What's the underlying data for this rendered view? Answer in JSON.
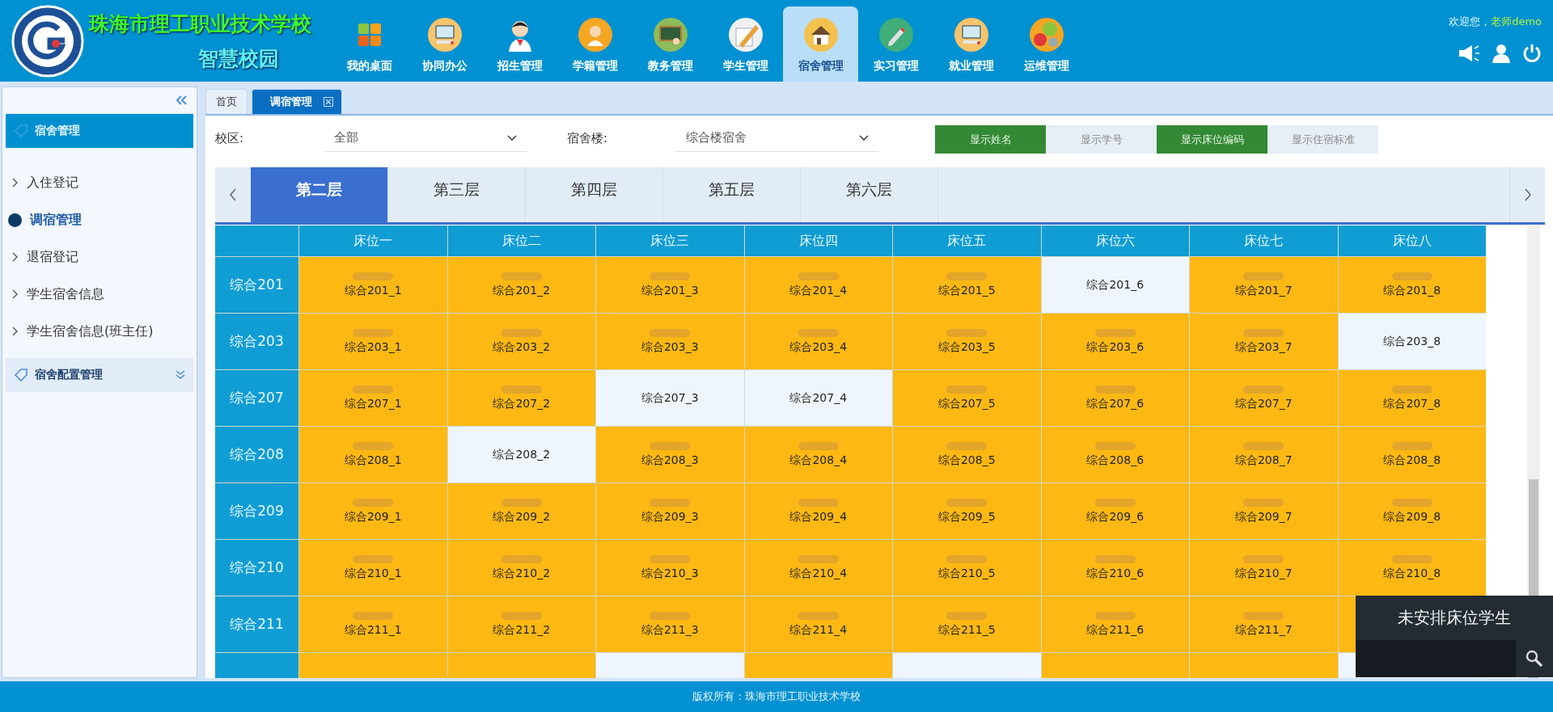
{
  "header": {
    "school_name": "珠海市理工职业技术学校",
    "subtitle": "智慧校园",
    "welcome": "欢迎您，",
    "user": "老师demo",
    "nav": [
      {
        "label": "我的桌面",
        "kind": "tiles",
        "selected": false
      },
      {
        "label": "协同办公",
        "kind": "computer",
        "selected": false
      },
      {
        "label": "招生管理",
        "kind": "student",
        "selected": false
      },
      {
        "label": "学籍管理",
        "kind": "person",
        "selected": false
      },
      {
        "label": "教务管理",
        "kind": "board",
        "selected": false
      },
      {
        "label": "学生管理",
        "kind": "paper",
        "selected": false
      },
      {
        "label": "宿舍管理",
        "kind": "house",
        "selected": true
      },
      {
        "label": "实习管理",
        "kind": "pencil",
        "selected": false
      },
      {
        "label": "就业管理",
        "kind": "computer",
        "selected": false
      },
      {
        "label": "运维管理",
        "kind": "gears",
        "selected": false
      }
    ]
  },
  "sidebar": {
    "groups": [
      {
        "title": "宿舍管理",
        "expanded": true,
        "items": [
          {
            "label": "入住登记",
            "selected": false
          },
          {
            "label": "调宿管理",
            "selected": true
          },
          {
            "label": "退宿登记",
            "selected": false
          },
          {
            "label": "学生宿舍信息",
            "selected": false
          },
          {
            "label": "学生宿舍信息(班主任)",
            "selected": false
          }
        ]
      },
      {
        "title": "宿舍配置管理",
        "expanded": false
      }
    ]
  },
  "page_tabs": [
    {
      "label": "首页",
      "selected": false,
      "closable": false
    },
    {
      "label": "调宿管理",
      "selected": true,
      "closable": true
    }
  ],
  "filters": [
    {
      "label": "校区:",
      "value": "全部"
    },
    {
      "label": "宿舍楼:",
      "value": "综合楼宿舍"
    }
  ],
  "toggles": [
    {
      "label": "显示姓名",
      "on": true
    },
    {
      "label": "显示学号",
      "on": false
    },
    {
      "label": "显示床位编码",
      "on": true
    },
    {
      "label": "显示住宿标准",
      "on": false
    }
  ],
  "floors": [
    {
      "label": "第二层",
      "selected": true
    },
    {
      "label": "第三层",
      "selected": false
    },
    {
      "label": "第四层",
      "selected": false
    },
    {
      "label": "第五层",
      "selected": false
    },
    {
      "label": "第六层",
      "selected": false
    }
  ],
  "bed_columns": [
    "床位一",
    "床位二",
    "床位三",
    "床位四",
    "床位五",
    "床位六",
    "床位七",
    "床位八"
  ],
  "rooms": [
    {
      "name": "综合201",
      "beds": [
        {
          "code": "综合201_1",
          "occupied": true
        },
        {
          "code": "综合201_2",
          "occupied": true
        },
        {
          "code": "综合201_3",
          "occupied": true
        },
        {
          "code": "综合201_4",
          "occupied": true
        },
        {
          "code": "综合201_5",
          "occupied": true
        },
        {
          "code": "综合201_6",
          "occupied": false
        },
        {
          "code": "综合201_7",
          "occupied": true
        },
        {
          "code": "综合201_8",
          "occupied": true
        }
      ]
    },
    {
      "name": "综合203",
      "beds": [
        {
          "code": "综合203_1",
          "occupied": true
        },
        {
          "code": "综合203_2",
          "occupied": true
        },
        {
          "code": "综合203_3",
          "occupied": true
        },
        {
          "code": "综合203_4",
          "occupied": true
        },
        {
          "code": "综合203_5",
          "occupied": true
        },
        {
          "code": "综合203_6",
          "occupied": true
        },
        {
          "code": "综合203_7",
          "occupied": true
        },
        {
          "code": "综合203_8",
          "occupied": false
        }
      ]
    },
    {
      "name": "综合207",
      "beds": [
        {
          "code": "综合207_1",
          "occupied": true
        },
        {
          "code": "综合207_2",
          "occupied": true
        },
        {
          "code": "综合207_3",
          "occupied": false
        },
        {
          "code": "综合207_4",
          "occupied": false
        },
        {
          "code": "综合207_5",
          "occupied": true
        },
        {
          "code": "综合207_6",
          "occupied": true
        },
        {
          "code": "综合207_7",
          "occupied": true
        },
        {
          "code": "综合207_8",
          "occupied": true
        }
      ]
    },
    {
      "name": "综合208",
      "beds": [
        {
          "code": "综合208_1",
          "occupied": true
        },
        {
          "code": "综合208_2",
          "occupied": false
        },
        {
          "code": "综合208_3",
          "occupied": true
        },
        {
          "code": "综合208_4",
          "occupied": true
        },
        {
          "code": "综合208_5",
          "occupied": true
        },
        {
          "code": "综合208_6",
          "occupied": true
        },
        {
          "code": "综合208_7",
          "occupied": true
        },
        {
          "code": "综合208_8",
          "occupied": true
        }
      ]
    },
    {
      "name": "综合209",
      "beds": [
        {
          "code": "综合209_1",
          "occupied": true
        },
        {
          "code": "综合209_2",
          "occupied": true
        },
        {
          "code": "综合209_3",
          "occupied": true
        },
        {
          "code": "综合209_4",
          "occupied": true
        },
        {
          "code": "综合209_5",
          "occupied": true
        },
        {
          "code": "综合209_6",
          "occupied": true
        },
        {
          "code": "综合209_7",
          "occupied": true
        },
        {
          "code": "综合209_8",
          "occupied": true
        }
      ]
    },
    {
      "name": "综合210",
      "beds": [
        {
          "code": "综合210_1",
          "occupied": true
        },
        {
          "code": "综合210_2",
          "occupied": true
        },
        {
          "code": "综合210_3",
          "occupied": true
        },
        {
          "code": "综合210_4",
          "occupied": true
        },
        {
          "code": "综合210_5",
          "occupied": true
        },
        {
          "code": "综合210_6",
          "occupied": true
        },
        {
          "code": "综合210_7",
          "occupied": true
        },
        {
          "code": "综合210_8",
          "occupied": true
        }
      ]
    },
    {
      "name": "综合211",
      "beds": [
        {
          "code": "综合211_1",
          "occupied": true
        },
        {
          "code": "综合211_2",
          "occupied": true
        },
        {
          "code": "综合211_3",
          "occupied": true
        },
        {
          "code": "综合211_4",
          "occupied": true
        },
        {
          "code": "综合211_5",
          "occupied": true
        },
        {
          "code": "综合211_6",
          "occupied": true
        },
        {
          "code": "综合211_7",
          "occupied": true
        },
        {
          "occupied": true
        }
      ]
    },
    {
      "beds": [
        {
          "occupied": true
        },
        {
          "occupied": true
        },
        {
          "occupied": false
        },
        {
          "occupied": true
        },
        {
          "occupied": false
        },
        {
          "occupied": true
        },
        {
          "occupied": true
        },
        {
          "occupied": false
        }
      ]
    }
  ],
  "unassigned_panel": {
    "title": "未安排床位学生"
  },
  "footer": {
    "text": "版权所有：珠海市理工职业技术学校"
  }
}
